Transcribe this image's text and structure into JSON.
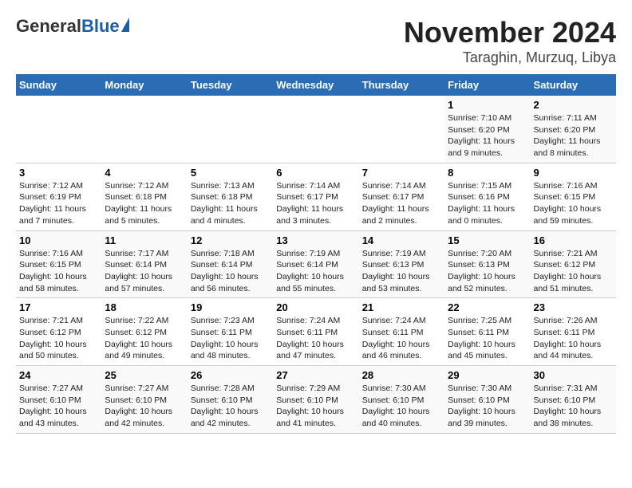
{
  "header": {
    "logo_general": "General",
    "logo_blue": "Blue",
    "month": "November 2024",
    "location": "Taraghin, Murzuq, Libya"
  },
  "weekdays": [
    "Sunday",
    "Monday",
    "Tuesday",
    "Wednesday",
    "Thursday",
    "Friday",
    "Saturday"
  ],
  "weeks": [
    [
      {
        "day": "",
        "info": ""
      },
      {
        "day": "",
        "info": ""
      },
      {
        "day": "",
        "info": ""
      },
      {
        "day": "",
        "info": ""
      },
      {
        "day": "",
        "info": ""
      },
      {
        "day": "1",
        "info": "Sunrise: 7:10 AM\nSunset: 6:20 PM\nDaylight: 11 hours and 9 minutes."
      },
      {
        "day": "2",
        "info": "Sunrise: 7:11 AM\nSunset: 6:20 PM\nDaylight: 11 hours and 8 minutes."
      }
    ],
    [
      {
        "day": "3",
        "info": "Sunrise: 7:12 AM\nSunset: 6:19 PM\nDaylight: 11 hours and 7 minutes."
      },
      {
        "day": "4",
        "info": "Sunrise: 7:12 AM\nSunset: 6:18 PM\nDaylight: 11 hours and 5 minutes."
      },
      {
        "day": "5",
        "info": "Sunrise: 7:13 AM\nSunset: 6:18 PM\nDaylight: 11 hours and 4 minutes."
      },
      {
        "day": "6",
        "info": "Sunrise: 7:14 AM\nSunset: 6:17 PM\nDaylight: 11 hours and 3 minutes."
      },
      {
        "day": "7",
        "info": "Sunrise: 7:14 AM\nSunset: 6:17 PM\nDaylight: 11 hours and 2 minutes."
      },
      {
        "day": "8",
        "info": "Sunrise: 7:15 AM\nSunset: 6:16 PM\nDaylight: 11 hours and 0 minutes."
      },
      {
        "day": "9",
        "info": "Sunrise: 7:16 AM\nSunset: 6:15 PM\nDaylight: 10 hours and 59 minutes."
      }
    ],
    [
      {
        "day": "10",
        "info": "Sunrise: 7:16 AM\nSunset: 6:15 PM\nDaylight: 10 hours and 58 minutes."
      },
      {
        "day": "11",
        "info": "Sunrise: 7:17 AM\nSunset: 6:14 PM\nDaylight: 10 hours and 57 minutes."
      },
      {
        "day": "12",
        "info": "Sunrise: 7:18 AM\nSunset: 6:14 PM\nDaylight: 10 hours and 56 minutes."
      },
      {
        "day": "13",
        "info": "Sunrise: 7:19 AM\nSunset: 6:14 PM\nDaylight: 10 hours and 55 minutes."
      },
      {
        "day": "14",
        "info": "Sunrise: 7:19 AM\nSunset: 6:13 PM\nDaylight: 10 hours and 53 minutes."
      },
      {
        "day": "15",
        "info": "Sunrise: 7:20 AM\nSunset: 6:13 PM\nDaylight: 10 hours and 52 minutes."
      },
      {
        "day": "16",
        "info": "Sunrise: 7:21 AM\nSunset: 6:12 PM\nDaylight: 10 hours and 51 minutes."
      }
    ],
    [
      {
        "day": "17",
        "info": "Sunrise: 7:21 AM\nSunset: 6:12 PM\nDaylight: 10 hours and 50 minutes."
      },
      {
        "day": "18",
        "info": "Sunrise: 7:22 AM\nSunset: 6:12 PM\nDaylight: 10 hours and 49 minutes."
      },
      {
        "day": "19",
        "info": "Sunrise: 7:23 AM\nSunset: 6:11 PM\nDaylight: 10 hours and 48 minutes."
      },
      {
        "day": "20",
        "info": "Sunrise: 7:24 AM\nSunset: 6:11 PM\nDaylight: 10 hours and 47 minutes."
      },
      {
        "day": "21",
        "info": "Sunrise: 7:24 AM\nSunset: 6:11 PM\nDaylight: 10 hours and 46 minutes."
      },
      {
        "day": "22",
        "info": "Sunrise: 7:25 AM\nSunset: 6:11 PM\nDaylight: 10 hours and 45 minutes."
      },
      {
        "day": "23",
        "info": "Sunrise: 7:26 AM\nSunset: 6:11 PM\nDaylight: 10 hours and 44 minutes."
      }
    ],
    [
      {
        "day": "24",
        "info": "Sunrise: 7:27 AM\nSunset: 6:10 PM\nDaylight: 10 hours and 43 minutes."
      },
      {
        "day": "25",
        "info": "Sunrise: 7:27 AM\nSunset: 6:10 PM\nDaylight: 10 hours and 42 minutes."
      },
      {
        "day": "26",
        "info": "Sunrise: 7:28 AM\nSunset: 6:10 PM\nDaylight: 10 hours and 42 minutes."
      },
      {
        "day": "27",
        "info": "Sunrise: 7:29 AM\nSunset: 6:10 PM\nDaylight: 10 hours and 41 minutes."
      },
      {
        "day": "28",
        "info": "Sunrise: 7:30 AM\nSunset: 6:10 PM\nDaylight: 10 hours and 40 minutes."
      },
      {
        "day": "29",
        "info": "Sunrise: 7:30 AM\nSunset: 6:10 PM\nDaylight: 10 hours and 39 minutes."
      },
      {
        "day": "30",
        "info": "Sunrise: 7:31 AM\nSunset: 6:10 PM\nDaylight: 10 hours and 38 minutes."
      }
    ]
  ]
}
